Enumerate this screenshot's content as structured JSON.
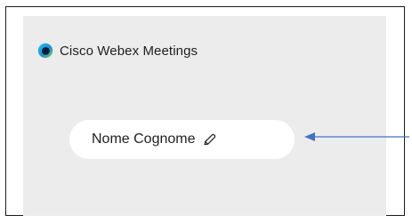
{
  "app": {
    "title": "Cisco Webex Meetings",
    "logo_icon": "webex-logo-icon"
  },
  "profile": {
    "display_name": "Nome Cognome",
    "edit_icon": "pencil-icon"
  },
  "annotation": {
    "arrow_icon": "arrow-left-icon",
    "arrow_color": "#4472c4"
  },
  "colors": {
    "panel_background": "#ececec",
    "pill_background": "#ffffff",
    "frame_border": "#1a1a1a",
    "text": "#1e1e1e"
  }
}
